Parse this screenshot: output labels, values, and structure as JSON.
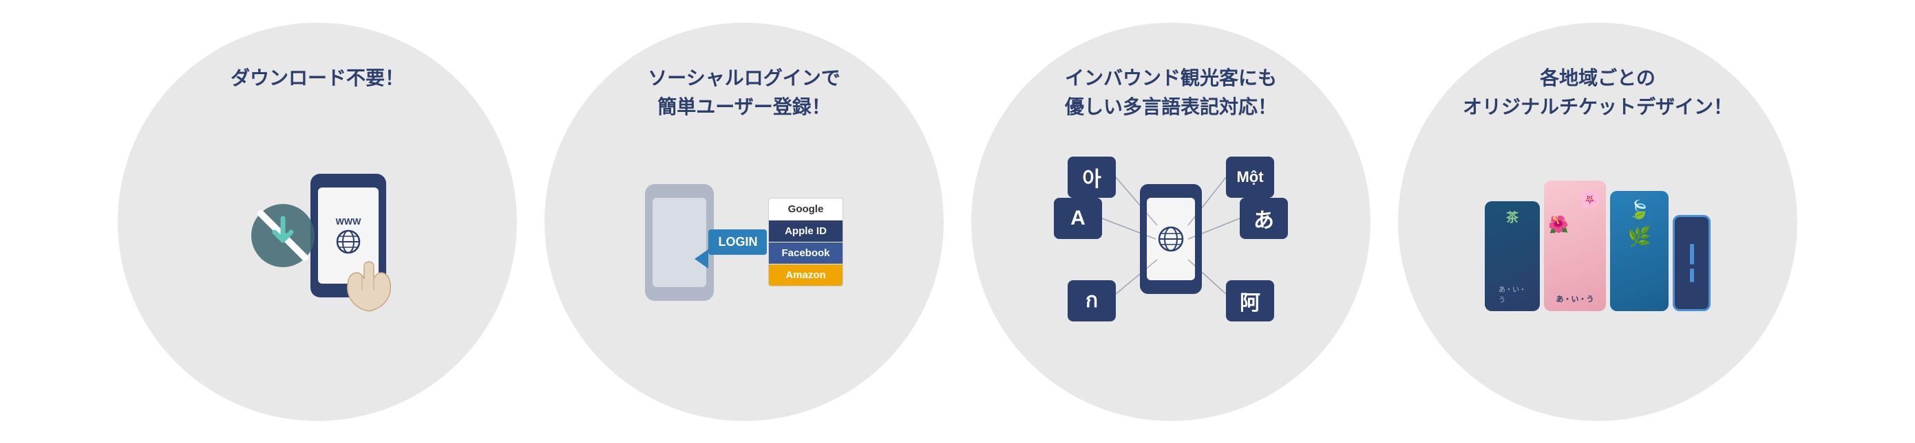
{
  "circles": [
    {
      "id": "no-download",
      "title": "ダウンロード不要！",
      "www": "WWW"
    },
    {
      "id": "social-login",
      "title_line1": "ソーシャルログインで",
      "title_line2": "簡単ユーザー登録！",
      "login_label": "LOGIN",
      "options": [
        {
          "label": "Google",
          "style": "google"
        },
        {
          "label": "Apple ID",
          "style": "apple"
        },
        {
          "label": "Facebook",
          "style": "facebook"
        },
        {
          "label": "Amazon",
          "style": "amazon"
        }
      ]
    },
    {
      "id": "multilingual",
      "title_line1": "インバウンド観光客にも",
      "title_line2": "優しい多言語表記対応！",
      "lang_blocks": [
        "아",
        "A",
        "ก",
        "Một",
        "あ",
        "阿"
      ]
    },
    {
      "id": "ticket-design",
      "title_line1": "各地域ごとの",
      "title_line2": "オリジナルチケットデザイン！",
      "deco_text": "あ・い・う"
    }
  ]
}
